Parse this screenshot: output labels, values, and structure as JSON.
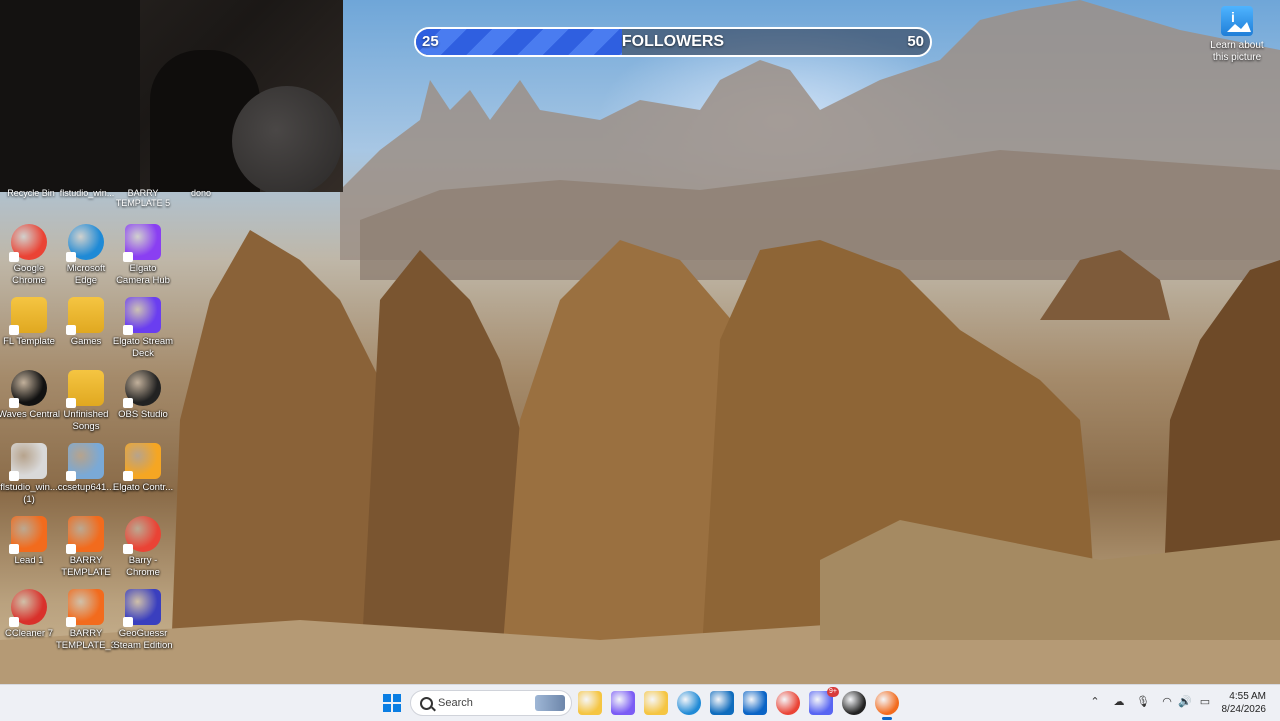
{
  "followers": {
    "min": "25",
    "label": "FOLLOWERS",
    "max": "50",
    "progress_fraction": 0.4
  },
  "learn_picture": {
    "label": "Learn about this picture"
  },
  "top_row_labels": [
    "Recycle Bin",
    "flstudio_win...",
    "BARRY TEMPLATE 5",
    "dono"
  ],
  "desktop_icons": [
    {
      "label": "Google Chrome",
      "icon": "chrome-icon",
      "color": "#ea4335"
    },
    {
      "label": "Microsoft Edge",
      "icon": "edge-icon",
      "color": "#1f8ad6"
    },
    {
      "label": "Elgato Camera Hub",
      "icon": "camera-hub-icon",
      "color": "#8a3ff2"
    },
    {
      "label": "FL Template",
      "icon": "folder-icon",
      "color": "#f5c542"
    },
    {
      "label": "Games",
      "icon": "folder-icon",
      "color": "#f5c542"
    },
    {
      "label": "Elgato Stream Deck",
      "icon": "stream-deck-icon",
      "color": "#6a3ef0"
    },
    {
      "label": "Waves Central",
      "icon": "waves-icon",
      "color": "#111111"
    },
    {
      "label": "Unfinished Songs",
      "icon": "folder-icon",
      "color": "#f5c542"
    },
    {
      "label": "OBS Studio",
      "icon": "obs-icon",
      "color": "#222222"
    },
    {
      "label": "flstudio_win... (1)",
      "icon": "installer-icon",
      "color": "#d9d9d9"
    },
    {
      "label": "ccsetup641...",
      "icon": "installer-icon",
      "color": "#7aa9d6"
    },
    {
      "label": "Elgato Contr...",
      "icon": "elgato-control-icon",
      "color": "#f5a623"
    },
    {
      "label": "Lead 1",
      "icon": "fl-studio-icon",
      "color": "#f26b1d"
    },
    {
      "label": "BARRY TEMPLATE",
      "icon": "fl-studio-icon",
      "color": "#f26b1d"
    },
    {
      "label": "Barry - Chrome",
      "icon": "chrome-profile-icon",
      "color": "#ea4335"
    },
    {
      "label": "CCleaner 7",
      "icon": "ccleaner-icon",
      "color": "#d9312b"
    },
    {
      "label": "BARRY TEMPLATE_3",
      "icon": "fl-studio-icon",
      "color": "#f26b1d"
    },
    {
      "label": "GeoGuessr Steam Edition",
      "icon": "geoguessr-icon",
      "color": "#3a3fbf"
    }
  ],
  "taskbar": {
    "search_label": "Search",
    "apps": [
      {
        "name": "file-explorer-taskbar-icon",
        "color": "#f5c542"
      },
      {
        "name": "copilot-taskbar-icon",
        "color": "#7b5cf5"
      },
      {
        "name": "folder-taskbar-icon",
        "color": "#f5c542"
      },
      {
        "name": "edge-taskbar-icon",
        "color": "#1f8ad6"
      },
      {
        "name": "store-taskbar-icon",
        "color": "#0f6cbd"
      },
      {
        "name": "outlook-taskbar-icon",
        "color": "#0a64c6"
      },
      {
        "name": "chrome-taskbar-icon",
        "color": "#ea4335"
      },
      {
        "name": "discord-taskbar-icon",
        "color": "#5865f2"
      },
      {
        "name": "obs-taskbar-icon",
        "color": "#222222"
      },
      {
        "name": "fl-studio-taskbar-icon",
        "color": "#f26b1d"
      }
    ],
    "discord_badge": "9+",
    "time": "4:55 AM",
    "date": "8/24/2026"
  }
}
